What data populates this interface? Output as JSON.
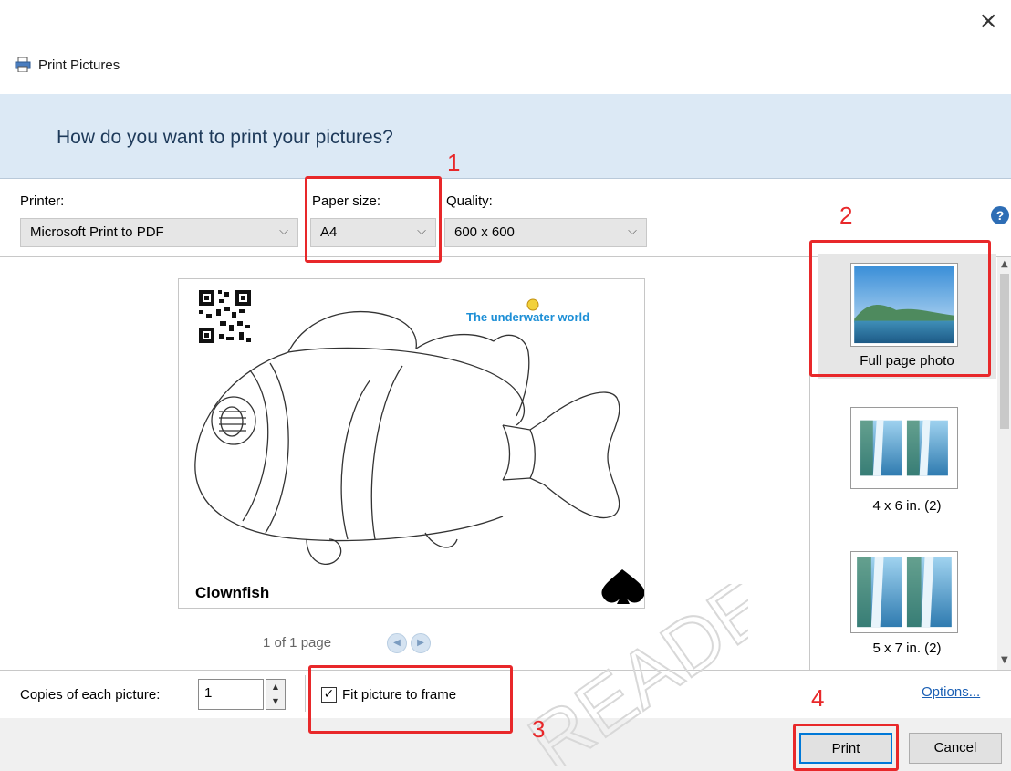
{
  "window": {
    "title": "Print Pictures",
    "close_glyph": "×"
  },
  "header": {
    "question": "How do you want to print your pictures?"
  },
  "controls": {
    "printer_label": "Printer:",
    "printer_value": "Microsoft Print to PDF",
    "paper_size_label": "Paper size:",
    "paper_size_value": "A4",
    "quality_label": "Quality:",
    "quality_value": "600 x 600",
    "help_glyph": "?"
  },
  "preview": {
    "logo_text": "The underwater world",
    "caption": "Clownfish",
    "page_info": "1 of 1 page",
    "prev_glyph": "◀",
    "next_glyph": "▶"
  },
  "layouts": [
    {
      "label": "Full page photo",
      "selected": true
    },
    {
      "label": "4 x 6 in. (2)",
      "selected": false
    },
    {
      "label": "5 x 7 in. (2)",
      "selected": false
    }
  ],
  "bottom": {
    "copies_label": "Copies of each picture:",
    "copies_value": "1",
    "fit_label": "Fit picture to frame",
    "fit_checked": true,
    "options_label": "Options..."
  },
  "buttons": {
    "print": "Print",
    "cancel": "Cancel"
  },
  "annotations": [
    "1",
    "2",
    "3",
    "4"
  ],
  "watermark_text": "READER",
  "colors": {
    "annotation_red": "#e8282a",
    "header_band": "#dce9f5",
    "link_blue": "#1a5fb4",
    "accent_blue": "#0078d7"
  },
  "icons": {
    "title": "printer-icon",
    "help": "help-icon",
    "dropdown": "chevron-down-icon",
    "close": "close-icon",
    "checkbox": "checkmark-icon"
  }
}
